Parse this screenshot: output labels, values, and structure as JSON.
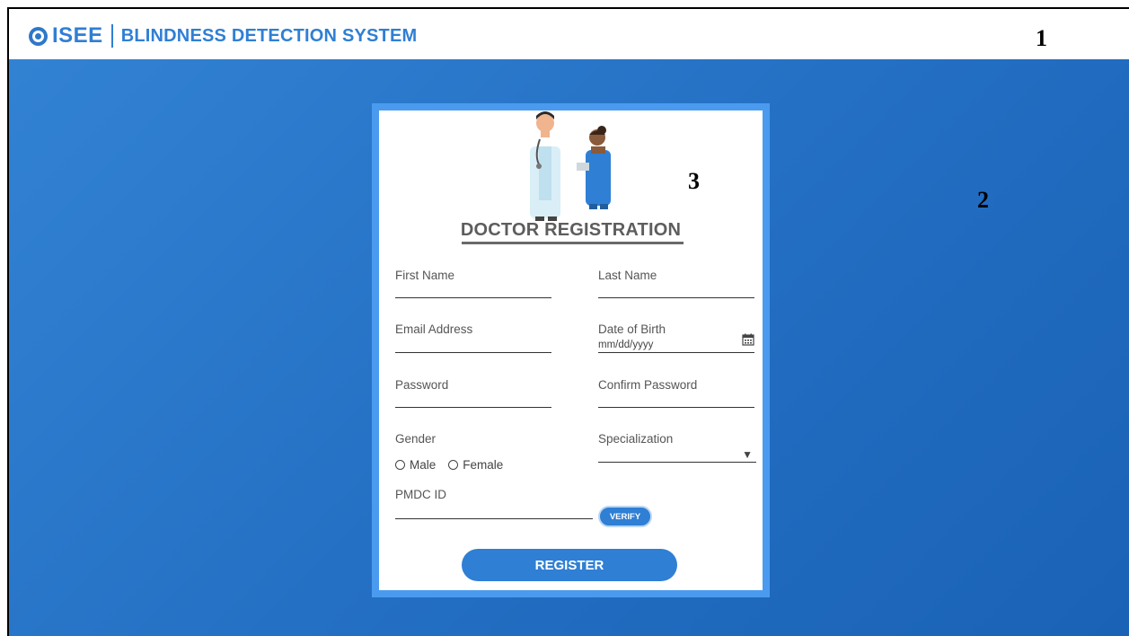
{
  "header": {
    "logo_text": "ISEE",
    "app_title": "BLINDNESS DETECTION SYSTEM",
    "marker": "1"
  },
  "background": {
    "marker": "2"
  },
  "card": {
    "marker": "3",
    "title": "DOCTOR REGISTRATION",
    "fields": {
      "first_name": "First Name",
      "last_name": "Last Name",
      "email": "Email Address",
      "dob": "Date of Birth",
      "dob_placeholder": "mm/dd/yyyy",
      "password": "Password",
      "confirm_password": "Confirm Password",
      "gender": "Gender",
      "gender_options": [
        "Male",
        "Female"
      ],
      "specialization": "Specialization",
      "pmdc_id": "PMDC ID"
    },
    "verify_label": "VERIFY",
    "register_label": "REGISTER"
  },
  "colors": {
    "brand": "#2f7fd4",
    "background_start": "#3282d3",
    "background_end": "#1a62b6",
    "card_border": "#4a9bf0"
  },
  "icons": [
    "eye-logo-icon",
    "calendar-icon",
    "dropdown-caret-icon",
    "doctors-illustration"
  ]
}
